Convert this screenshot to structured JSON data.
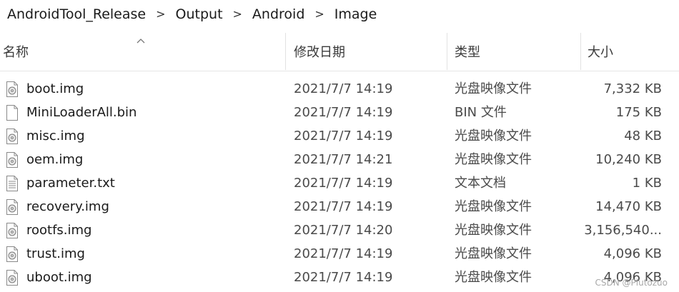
{
  "breadcrumb": {
    "items": [
      "AndroidTool_Release",
      "Output",
      "Android",
      "Image"
    ],
    "separator": ">"
  },
  "columns": {
    "name": "名称",
    "date": "修改日期",
    "type": "类型",
    "size": "大小",
    "sort_indicator": "^"
  },
  "files": [
    {
      "name": "boot.img",
      "date": "2021/7/7 14:19",
      "type": "光盘映像文件",
      "size": "7,332 KB",
      "icon": "disc-image-file-icon"
    },
    {
      "name": "MiniLoaderAll.bin",
      "date": "2021/7/7 14:19",
      "type": "BIN 文件",
      "size": "175 KB",
      "icon": "blank-file-icon"
    },
    {
      "name": "misc.img",
      "date": "2021/7/7 14:19",
      "type": "光盘映像文件",
      "size": "48 KB",
      "icon": "disc-image-file-icon"
    },
    {
      "name": "oem.img",
      "date": "2021/7/7 14:21",
      "type": "光盘映像文件",
      "size": "10,240 KB",
      "icon": "disc-image-file-icon"
    },
    {
      "name": "parameter.txt",
      "date": "2021/7/7 14:19",
      "type": "文本文档",
      "size": "1 KB",
      "icon": "text-file-icon"
    },
    {
      "name": "recovery.img",
      "date": "2021/7/7 14:19",
      "type": "光盘映像文件",
      "size": "14,470 KB",
      "icon": "disc-image-file-icon"
    },
    {
      "name": "rootfs.img",
      "date": "2021/7/7 14:20",
      "type": "光盘映像文件",
      "size": "3,156,540...",
      "icon": "disc-image-file-icon"
    },
    {
      "name": "trust.img",
      "date": "2021/7/7 14:19",
      "type": "光盘映像文件",
      "size": "4,096 KB",
      "icon": "disc-image-file-icon"
    },
    {
      "name": "uboot.img",
      "date": "2021/7/7 14:19",
      "type": "光盘映像文件",
      "size": "4,096 KB",
      "icon": "disc-image-file-icon"
    }
  ],
  "watermark": "CSDN @Plutozuo",
  "colors": {
    "text": "#1a1a1a",
    "secondary_text": "#4a4a4a",
    "divider": "#e2e2e2"
  }
}
